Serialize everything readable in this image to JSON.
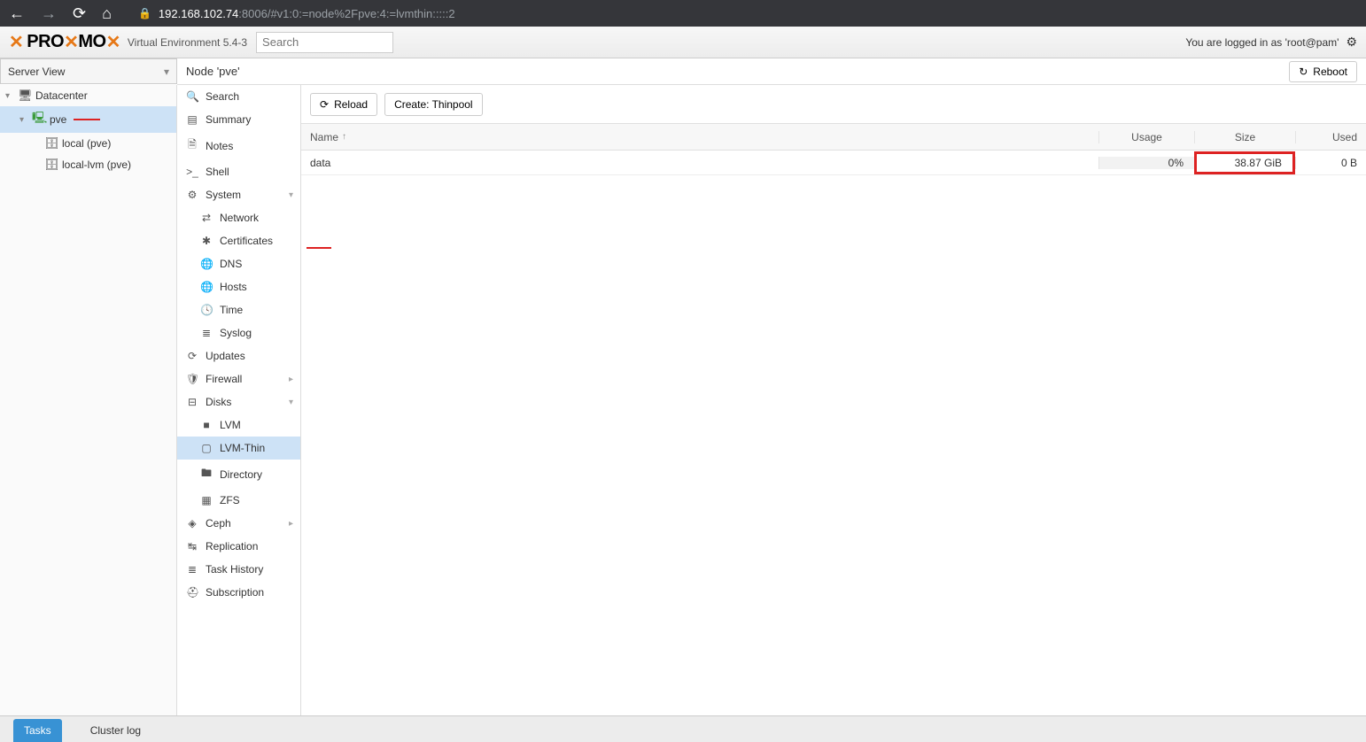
{
  "browser": {
    "url_host": "192.168.102.74",
    "url_rest": ":8006/#v1:0:=node%2Fpve:4:=lvmthin:::::2"
  },
  "header": {
    "logo_text": "PROXMOX",
    "env": "Virtual Environment 5.4-3",
    "search_placeholder": "Search",
    "login_text": "You are logged in as 'root@pam'"
  },
  "view_selector": "Server View",
  "node_title": "Node 'pve'",
  "reboot_label": "Reboot",
  "tree": {
    "datacenter": "Datacenter",
    "pve": "pve",
    "local": "local (pve)",
    "local_lvm": "local-lvm (pve)"
  },
  "midnav": {
    "search": "Search",
    "summary": "Summary",
    "notes": "Notes",
    "shell": "Shell",
    "system": "System",
    "network": "Network",
    "certificates": "Certificates",
    "dns": "DNS",
    "hosts": "Hosts",
    "time": "Time",
    "syslog": "Syslog",
    "updates": "Updates",
    "firewall": "Firewall",
    "disks": "Disks",
    "lvm": "LVM",
    "lvmthin": "LVM-Thin",
    "directory": "Directory",
    "zfs": "ZFS",
    "ceph": "Ceph",
    "replication": "Replication",
    "taskhistory": "Task History",
    "subscription": "Subscription"
  },
  "toolbar": {
    "reload": "Reload",
    "create": "Create: Thinpool"
  },
  "table": {
    "headers": {
      "name": "Name",
      "usage": "Usage",
      "size": "Size",
      "used": "Used"
    },
    "rows": [
      {
        "name": "data",
        "usage": "0%",
        "size": "38.87 GiB",
        "used": "0 B"
      }
    ]
  },
  "bottom": {
    "tasks": "Tasks",
    "clusterlog": "Cluster log"
  }
}
